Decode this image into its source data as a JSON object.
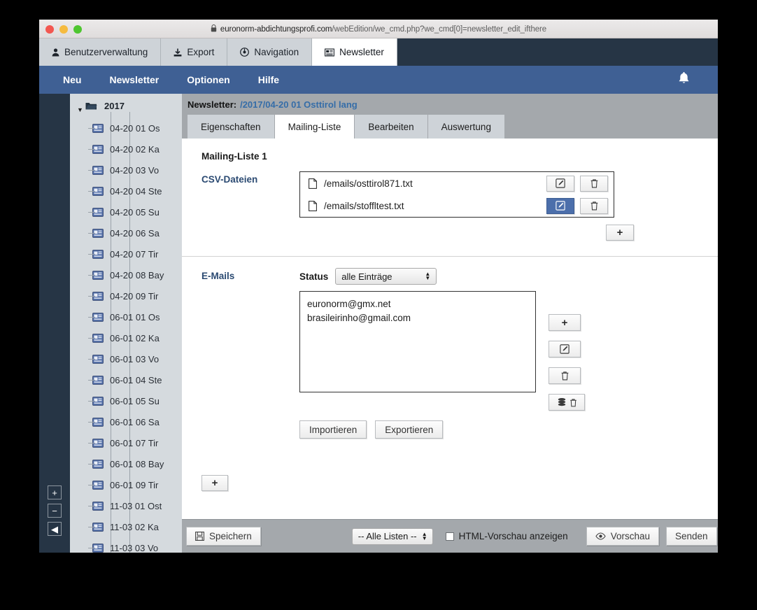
{
  "browser": {
    "url_lock": "lock-icon",
    "url_host": "euronorm-abdichtungsprofi.com",
    "url_path": "/webEdition/we_cmd.php?we_cmd[0]=newsletter_edit_ifthere"
  },
  "app_tabs": [
    {
      "label": "Benutzerverwaltung",
      "icon": "user-icon",
      "active": false
    },
    {
      "label": "Export",
      "icon": "download-icon",
      "active": false
    },
    {
      "label": "Navigation",
      "icon": "compass-icon",
      "active": false
    },
    {
      "label": "Newsletter",
      "icon": "newspaper-icon",
      "active": true
    }
  ],
  "menubar": {
    "items": [
      "Neu",
      "Newsletter",
      "Optionen",
      "Hilfe"
    ],
    "bell": "bell-icon"
  },
  "sidebar": {
    "root": {
      "label": "2017",
      "icon": "folder-open-icon",
      "arrow": "▼"
    },
    "items": [
      "04-20 01 Os",
      "04-20 02 Ka",
      "04-20 03 Vo",
      "04-20 04 Ste",
      "04-20 05 Su",
      "04-20 06 Sa",
      "04-20 07 Tir",
      "04-20 08 Bay",
      "04-20 09 Tir",
      "06-01 01 Os",
      "06-01 02 Ka",
      "06-01 03 Vo",
      "06-01 04 Ste",
      "06-01 05 Su",
      "06-01 06 Sa",
      "06-01 07 Tir",
      "06-01 08 Bay",
      "06-01 09 Tir",
      "11-03 01 Ost",
      "11-03 02 Ka",
      "11-03 03 Vo"
    ],
    "controls": [
      {
        "name": "zoom-in-button",
        "glyph": "+"
      },
      {
        "name": "zoom-out-button",
        "glyph": "−"
      },
      {
        "name": "collapse-button",
        "glyph": "◀"
      }
    ]
  },
  "breadcrumb": {
    "label": "Newsletter:",
    "path": "/2017/04-20 01 Osttirol lang"
  },
  "tabs": [
    {
      "label": "Eigenschaften",
      "active": false
    },
    {
      "label": "Mailing-Liste",
      "active": true
    },
    {
      "label": "Bearbeiten",
      "active": false
    },
    {
      "label": "Auswertung",
      "active": false
    }
  ],
  "main": {
    "section_title": "Mailing-Liste 1",
    "csv": {
      "label": "CSV-Dateien",
      "files": [
        {
          "name": "/emails/osttirol871.txt",
          "edit_selected": false
        },
        {
          "name": "/emails/stoffltest.txt",
          "edit_selected": true
        }
      ],
      "add_glyph": "+"
    },
    "emails": {
      "label": "E-Mails",
      "status_label": "Status",
      "status_value": "alle Einträge",
      "status_options": [
        "alle Einträge"
      ],
      "list": [
        "euronorm@gmx.net",
        "brasileirinho@gmail.com"
      ],
      "side_buttons": [
        {
          "name": "add-email-button",
          "icon": "plus-icon",
          "glyph": "+"
        },
        {
          "name": "edit-email-button",
          "icon": "edit-icon",
          "glyph": ""
        },
        {
          "name": "delete-email-button",
          "icon": "trash-icon",
          "glyph": ""
        },
        {
          "name": "delete-all-emails-button",
          "icon": "database-trash-icon",
          "glyph": ""
        }
      ],
      "import_label": "Importieren",
      "export_label": "Exportieren"
    },
    "add_list_glyph": "+"
  },
  "footer": {
    "save_label": "Speichern",
    "save_icon": "save-icon",
    "list_select_value": "-- Alle Listen --",
    "list_select_options": [
      "-- Alle Listen --"
    ],
    "html_preview_label": "HTML-Vorschau anzeigen",
    "html_preview_checked": false,
    "preview_label": "Vorschau",
    "preview_icon": "eye-icon",
    "send_label": "Senden"
  },
  "colors": {
    "accent_blue": "#3f6094",
    "dark_navy": "#263545",
    "link_blue": "#356da8",
    "label_blue": "#2b4a72",
    "selected_button": "#4c6fab",
    "panel_gray": "#a4a8ac",
    "tree_gray": "#d5dade"
  }
}
